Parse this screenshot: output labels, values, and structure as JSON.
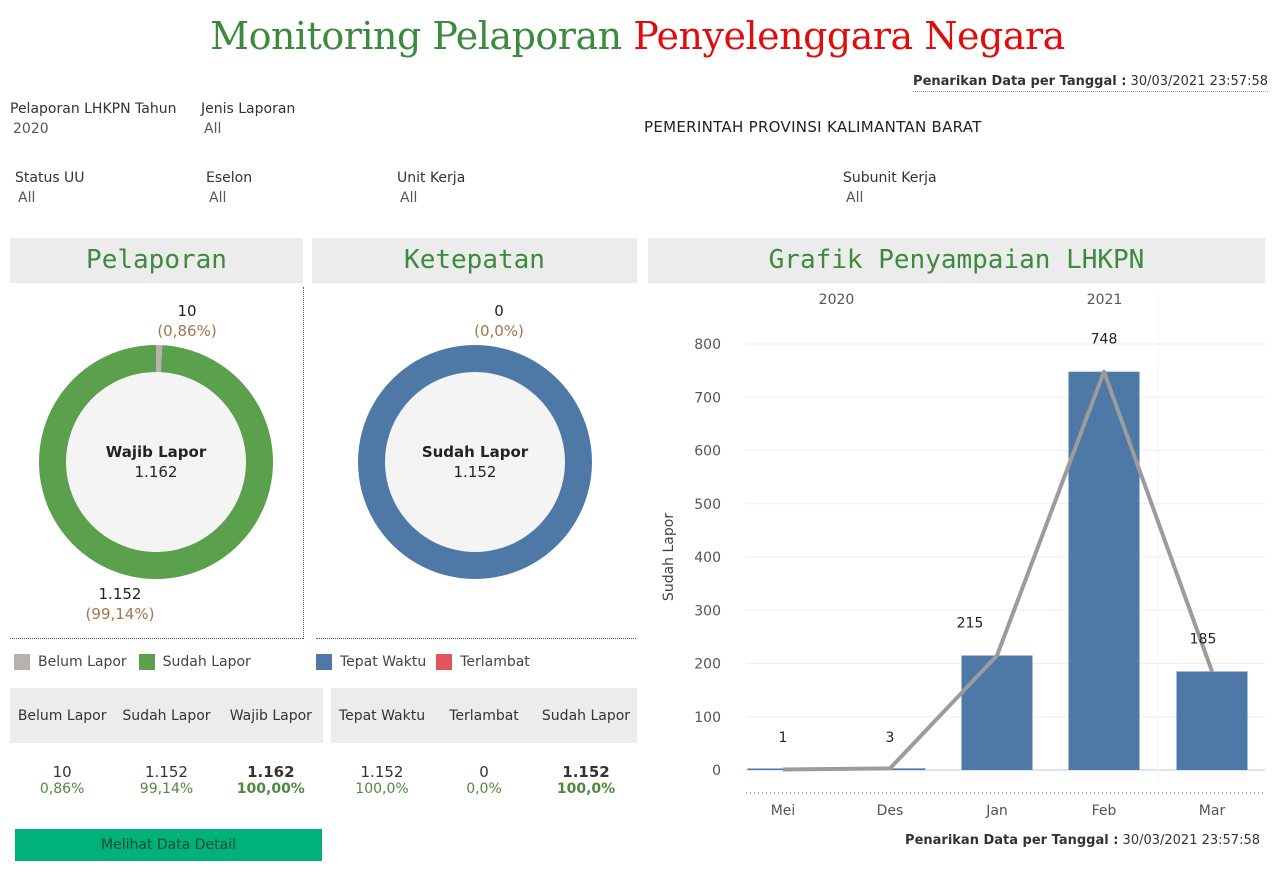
{
  "header": {
    "title_part1": "Monitoring Pelaporan",
    "title_part2": "Penyelenggara Negara",
    "stamp_label": "Penarikan Data per Tanggal :",
    "stamp_value": "30/03/2021 23:57:58"
  },
  "filters": {
    "tahun": {
      "label": "Pelaporan LHKPN Tahun",
      "value": "2020"
    },
    "jenis": {
      "label": "Jenis Laporan",
      "value": "All"
    },
    "status": {
      "label": "Status UU",
      "value": "All"
    },
    "eselon": {
      "label": "Eselon",
      "value": "All"
    },
    "unit": {
      "label": "Unit Kerja",
      "value": "All"
    },
    "subunit": {
      "label": "Subunit Kerja",
      "value": "All"
    }
  },
  "agency": "PEMERINTAH PROVINSI KALIMANTAN BARAT",
  "colors": {
    "green": "#5aa04d",
    "grey": "#bab0ac",
    "blue": "#4e79a7",
    "red": "#e15759",
    "title_green": "#3c8a3e",
    "title_red": "#e10c0c",
    "button": "#00b27a"
  },
  "pelaporan": {
    "heading": "Pelaporan",
    "center_label": "Wajib Lapor",
    "center_value": "1.162",
    "top_value": "10",
    "top_pct": "(0,86%)",
    "bottom_value": "1.152",
    "bottom_pct": "(99,14%)",
    "legend": [
      {
        "label": "Belum Lapor",
        "color": "#bab0ac"
      },
      {
        "label": "Sudah Lapor",
        "color": "#5aa04d"
      }
    ],
    "table": {
      "headers": [
        "Belum Lapor",
        "Sudah Lapor",
        "Wajib Lapor"
      ],
      "values": [
        "10",
        "1.152",
        "1.162"
      ],
      "pcts": [
        "0,86%",
        "99,14%",
        "100,00%"
      ]
    }
  },
  "ketepatan": {
    "heading": "Ketepatan",
    "center_label": "Sudah Lapor",
    "center_value": "1.152",
    "top_value": "0",
    "top_pct": "(0,0%)",
    "legend": [
      {
        "label": "Tepat Waktu",
        "color": "#4e79a7"
      },
      {
        "label": "Terlambat",
        "color": "#e15759"
      }
    ],
    "table": {
      "headers": [
        "Tepat Waktu",
        "Terlambat",
        "Sudah Lapor"
      ],
      "values": [
        "1.152",
        "0",
        "1.152"
      ],
      "pcts": [
        "100,0%",
        "0,0%",
        "100,0%"
      ]
    }
  },
  "grafik": {
    "heading": "Grafik Penyampaian LHKPN"
  },
  "detail_button": "Melihat Data Detail",
  "chart_data": [
    {
      "type": "pie",
      "title": "Pelaporan",
      "center_label": "Wajib Lapor",
      "center_value": 1162,
      "categories": [
        "Belum Lapor",
        "Sudah Lapor"
      ],
      "values": [
        10,
        1152
      ],
      "percentages": [
        0.86,
        99.14
      ]
    },
    {
      "type": "pie",
      "title": "Ketepatan",
      "center_label": "Sudah Lapor",
      "center_value": 1152,
      "categories": [
        "Tepat Waktu",
        "Terlambat"
      ],
      "values": [
        1152,
        0
      ],
      "percentages": [
        100.0,
        0.0
      ]
    },
    {
      "type": "bar",
      "title": "Grafik Penyampaian LHKPN",
      "ylabel": "Sudah Lapor",
      "xlabel": "",
      "year_groups": [
        {
          "year": "2020",
          "months": [
            "Mei",
            "Des"
          ]
        },
        {
          "year": "2021",
          "months": [
            "Jan",
            "Feb",
            "Mar"
          ]
        }
      ],
      "categories": [
        "Mei",
        "Des",
        "Jan",
        "Feb",
        "Mar"
      ],
      "values": [
        1,
        3,
        215,
        748,
        185
      ],
      "labels": [
        "1",
        "3",
        "215",
        "748",
        "185"
      ],
      "overlay_line": true,
      "ylim": [
        0,
        800
      ],
      "yticks": [
        0,
        100,
        200,
        300,
        400,
        500,
        600,
        700,
        800
      ],
      "grid": true
    }
  ]
}
